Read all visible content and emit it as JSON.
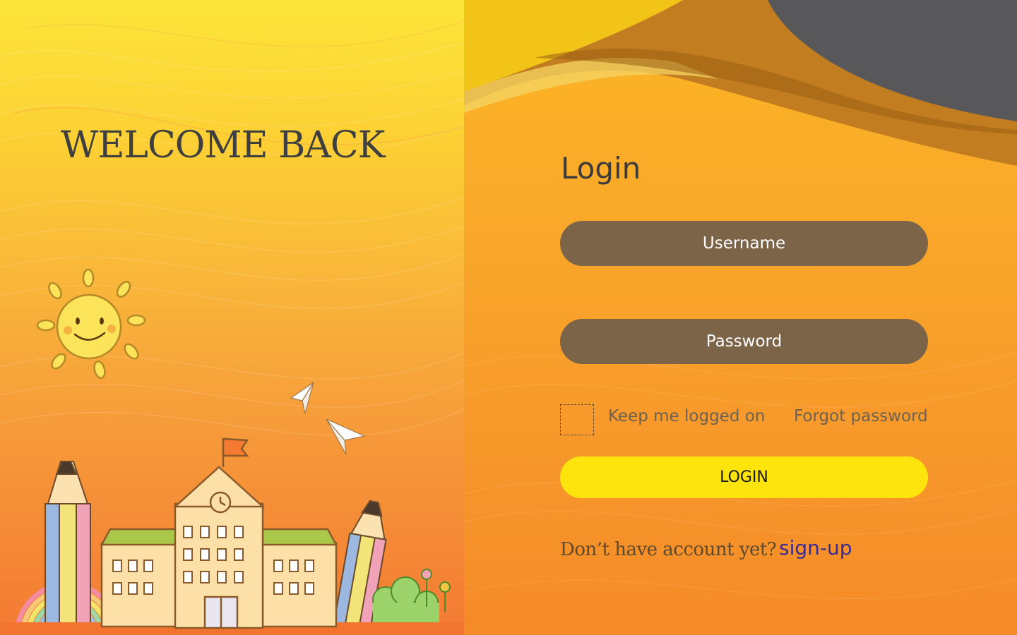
{
  "left": {
    "welcome_title": "WELCOME BACK"
  },
  "login_form": {
    "heading": "Login",
    "username_placeholder": "Username",
    "password_placeholder": "Password",
    "keep_logged_label": "Keep me logged on",
    "forgot_password_label": "Forgot password",
    "login_button_label": "LOGIN",
    "signup_prompt": "Don’t have account yet?",
    "signup_link_label": "sign-up"
  },
  "colors": {
    "left_gradient_top": "#fde53a",
    "left_gradient_bottom": "#f47a33",
    "right_background": "#f9a82a",
    "input_fill": "#7c6448",
    "login_button": "#fde40c",
    "signup_link": "#3a2a94",
    "header_swoosh_dark": "#58585a"
  }
}
